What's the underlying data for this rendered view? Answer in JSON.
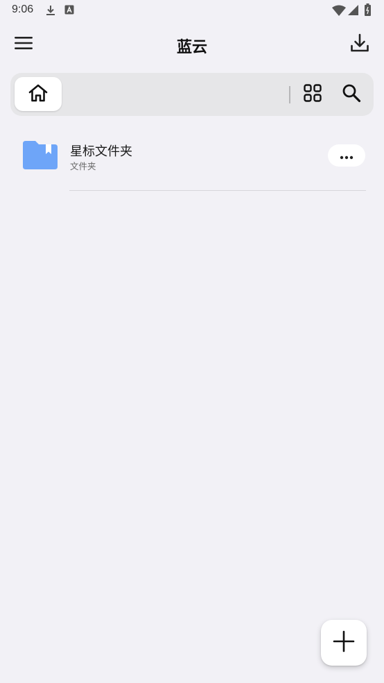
{
  "status_bar": {
    "time": "9:06",
    "icons": [
      "download-icon",
      "a-letter-icon",
      "wifi-icon",
      "signal-icon",
      "battery-icon"
    ]
  },
  "app_bar": {
    "title": "蓝云",
    "menu_icon": "menu-icon",
    "download_icon": "download-icon"
  },
  "toolbar": {
    "home_icon": "home-icon",
    "grid_icon": "grid-view-icon",
    "search_icon": "search-icon"
  },
  "files": [
    {
      "name": "星标文件夹",
      "type": "文件夹",
      "icon": "folder-icon",
      "icon_color": "#6ea5f8"
    }
  ],
  "fab": {
    "icon": "plus-icon"
  },
  "colors": {
    "background": "#f2f1f6",
    "toolbar": "#e6e6e8",
    "folder": "#6ea5f8"
  }
}
